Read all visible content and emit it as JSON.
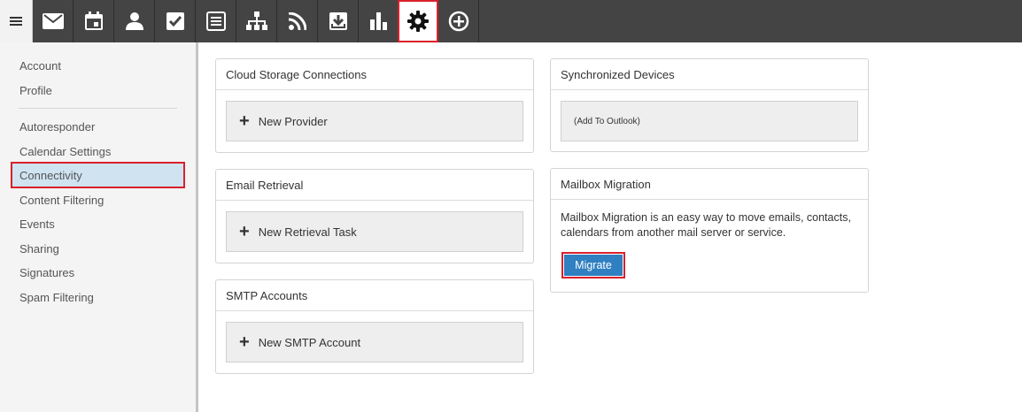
{
  "toolbar": {
    "buttons": [
      {
        "icon": "mail-icon"
      },
      {
        "icon": "calendar-icon"
      },
      {
        "icon": "contacts-icon"
      },
      {
        "icon": "tasks-icon"
      },
      {
        "icon": "notes-icon"
      },
      {
        "icon": "sitemap-icon"
      },
      {
        "icon": "rss-icon"
      },
      {
        "icon": "archive-icon"
      },
      {
        "icon": "reports-icon"
      },
      {
        "icon": "settings-gear-icon",
        "active": true
      },
      {
        "icon": "add-circle-icon"
      }
    ],
    "active_color": "#d9202a"
  },
  "sidebar": {
    "items": [
      {
        "label": "Account"
      },
      {
        "label": "Profile"
      },
      {
        "label": "Autoresponder"
      },
      {
        "label": "Calendar Settings"
      },
      {
        "label": "Connectivity",
        "selected": true
      },
      {
        "label": "Content Filtering"
      },
      {
        "label": "Events"
      },
      {
        "label": "Sharing"
      },
      {
        "label": "Signatures"
      },
      {
        "label": "Spam Filtering"
      }
    ]
  },
  "panels": {
    "cloud": {
      "title": "Cloud Storage Connections",
      "action": "New Provider"
    },
    "retrieval": {
      "title": "Email Retrieval",
      "action": "New Retrieval Task"
    },
    "smtp": {
      "title": "SMTP Accounts",
      "action": "New SMTP Account"
    },
    "devices": {
      "title": "Synchronized Devices",
      "action": "(Add To Outlook)"
    },
    "migration": {
      "title": "Mailbox Migration",
      "description": "Mailbox Migration is an easy way to move emails, contacts, calendars from another mail server or service.",
      "button": "Migrate"
    }
  },
  "colors": {
    "toolbar_bg": "#444444",
    "accent": "#2f7fc1",
    "highlight": "#d9202a",
    "selected_bg": "#cfe3f1"
  }
}
